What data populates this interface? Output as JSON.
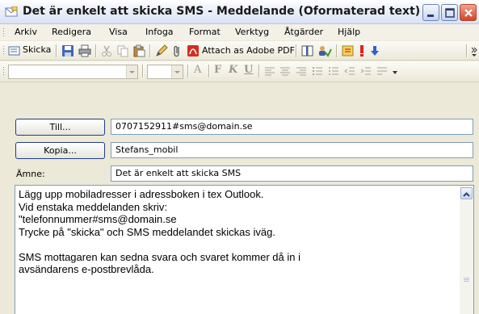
{
  "window": {
    "title": "Det är enkelt att skicka SMS - Meddelande (Oformaterad text)"
  },
  "menu": {
    "items": [
      "Arkiv",
      "Redigera",
      "Visa",
      "Infoga",
      "Format",
      "Verktyg",
      "Åtgärder",
      "Hjälp"
    ]
  },
  "toolbar": {
    "send_label": "Skicka",
    "attach_pdf_label": "Attach as Adobe PDF"
  },
  "format_bar": {
    "font_value": "",
    "size_value": ""
  },
  "header": {
    "to_label": "Till...",
    "cc_label": "Kopia...",
    "subject_label": "Ämne:",
    "to_value": "0707152911#sms@domain.se",
    "cc_value": "Stefans_mobil",
    "subject_value": "Det är enkelt att skicka SMS"
  },
  "body": {
    "text": "Lägg upp mobiladresser i adressboken i tex Outlook.\nVid enstaka meddelanden skriv:\n\"telefonnummer#sms@domain.se\nTrycke på \"skicka\" och SMS meddelandet skickas iväg.\n\nSMS mottagaren kan sedna svara och svaret kommer då in i\navsändarens e-postbrevlåda."
  },
  "colors": {
    "title_gradient_top": "#ffffff",
    "title_gradient_bottom": "#d9e3f4",
    "close_button": "#d0452a",
    "field_border": "#7f9db9",
    "button_border": "#1f3c86"
  },
  "icons": [
    "envelope-icon",
    "minimize-icon",
    "maximize-icon",
    "close-icon",
    "send-icon",
    "save-icon",
    "print-icon",
    "cut-icon",
    "copy-icon",
    "paste-icon",
    "pencil-icon",
    "attach-icon",
    "pdf-icon",
    "address-book-icon",
    "check-names-icon",
    "options-icon",
    "importance-high-icon",
    "importance-low-icon"
  ]
}
